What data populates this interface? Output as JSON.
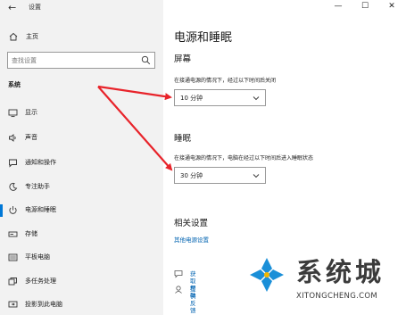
{
  "window": {
    "title": "设置",
    "back_icon": "back-arrow-icon",
    "controls": {
      "minimize": "—",
      "maximize": "☐",
      "close": "✕"
    }
  },
  "sidebar": {
    "home_label": "主页",
    "search_placeholder": "查找设置",
    "section_label": "系统",
    "items": [
      {
        "label": "显示",
        "icon": "monitor-icon",
        "active": false
      },
      {
        "label": "声音",
        "icon": "speaker-icon",
        "active": false
      },
      {
        "label": "通知和操作",
        "icon": "notification-icon",
        "active": false
      },
      {
        "label": "专注助手",
        "icon": "moon-icon",
        "active": false
      },
      {
        "label": "电源和睡眠",
        "icon": "power-icon",
        "active": true
      },
      {
        "label": "存储",
        "icon": "storage-icon",
        "active": false
      },
      {
        "label": "平板电脑",
        "icon": "tablet-icon",
        "active": false
      },
      {
        "label": "多任务处理",
        "icon": "multitask-icon",
        "active": false
      },
      {
        "label": "投影到此电脑",
        "icon": "project-icon",
        "active": false
      }
    ]
  },
  "main": {
    "page_title": "电源和睡眠",
    "screen": {
      "heading": "屏幕",
      "description": "在接通电源的情况下，经过以下时间后关闭",
      "value": "10 分钟"
    },
    "sleep": {
      "heading": "睡眠",
      "description": "在接通电源的情况下，电脑在经过以下时间后进入睡眠状态",
      "value": "30 分钟"
    },
    "related": {
      "heading": "相关设置",
      "link": "其他电源设置"
    },
    "help": {
      "get_help": "获取帮助",
      "feedback": "提供反馈"
    }
  },
  "watermark": {
    "text": "系统城",
    "sub": "XITONGCHENG.COM"
  },
  "colors": {
    "accent": "#0078d7",
    "link": "#0063b1",
    "sidebar_bg": "#f2f2f2",
    "annotation_arrow": "#e8232a",
    "logo_blue": "#1a8fd8"
  }
}
